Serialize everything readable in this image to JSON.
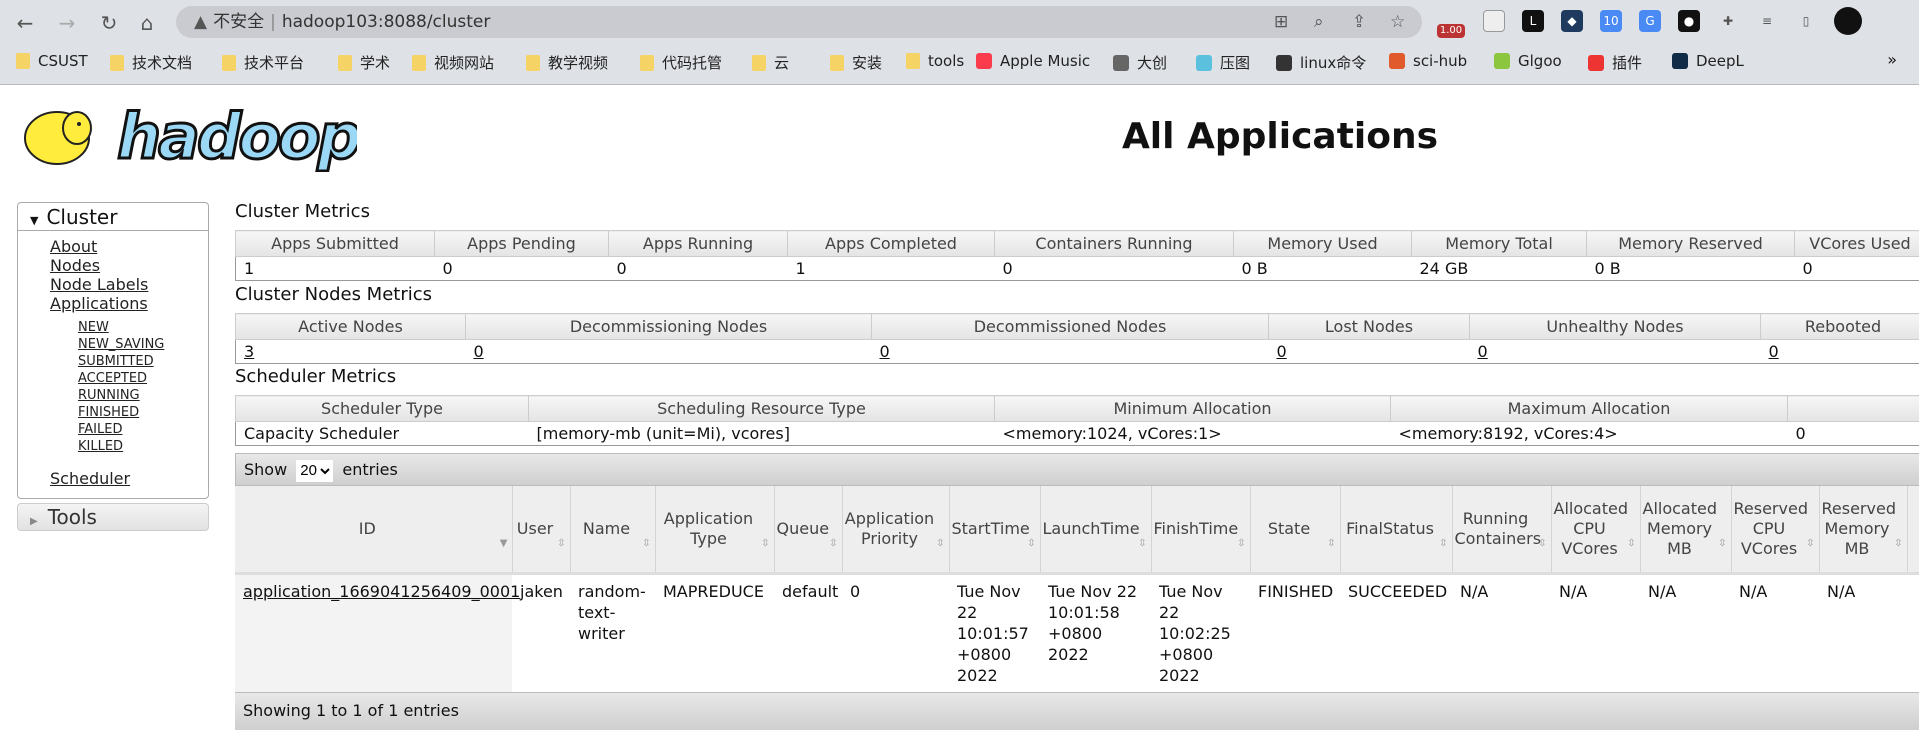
{
  "browser": {
    "security": "不安全",
    "url": "hadoop103:8088/cluster",
    "bookmarks": [
      {
        "label": "CSUST",
        "icon": "folder"
      },
      {
        "label": "技术文档",
        "icon": "folder"
      },
      {
        "label": "技术平台",
        "icon": "folder"
      },
      {
        "label": "学术",
        "icon": "folder"
      },
      {
        "label": "视频网站",
        "icon": "folder"
      },
      {
        "label": "教学视频",
        "icon": "folder"
      },
      {
        "label": "代码托管",
        "icon": "folder"
      },
      {
        "label": "云",
        "icon": "folder"
      },
      {
        "label": "安装",
        "icon": "folder"
      },
      {
        "label": "tools",
        "icon": "folder"
      },
      {
        "label": "Apple Music",
        "icon": "apple-music",
        "color": "#fa3c4c"
      },
      {
        "label": "大创",
        "icon": "globe",
        "color": "#666"
      },
      {
        "label": "压图",
        "icon": "compress",
        "color": "#5bc0de"
      },
      {
        "label": "linux命令",
        "icon": "tux",
        "color": "#333"
      },
      {
        "label": "sci-hub",
        "icon": "sci-hub",
        "color": "#e05a2b"
      },
      {
        "label": "Glgoo",
        "icon": "glgoo",
        "color": "#8cc63f"
      },
      {
        "label": "插件",
        "icon": "ex",
        "color": "#e33"
      },
      {
        "label": "DeepL",
        "icon": "deepl",
        "color": "#0f2b46"
      }
    ],
    "ext_badge": "1.00"
  },
  "page": {
    "title": "All Applications",
    "logo_text": "hadoop"
  },
  "sidebar": {
    "cluster": "Cluster",
    "links": [
      "About",
      "Nodes",
      "Node Labels",
      "Applications"
    ],
    "states": [
      "NEW",
      "NEW_SAVING",
      "SUBMITTED",
      "ACCEPTED",
      "RUNNING",
      "FINISHED",
      "FAILED",
      "KILLED"
    ],
    "scheduler": "Scheduler",
    "tools": "Tools"
  },
  "cluster_metrics": {
    "title": "Cluster Metrics",
    "headers": [
      "Apps Submitted",
      "Apps Pending",
      "Apps Running",
      "Apps Completed",
      "Containers Running",
      "Memory Used",
      "Memory Total",
      "Memory Reserved",
      "VCores Used"
    ],
    "values": [
      "1",
      "0",
      "0",
      "1",
      "0",
      "0 B",
      "24 GB",
      "0 B",
      "0"
    ]
  },
  "nodes_metrics": {
    "title": "Cluster Nodes Metrics",
    "headers": [
      "Active Nodes",
      "Decommissioning Nodes",
      "Decommissioned Nodes",
      "Lost Nodes",
      "Unhealthy Nodes",
      "Rebooted"
    ],
    "values": [
      "3",
      "0",
      "0",
      "0",
      "0",
      "0"
    ]
  },
  "scheduler_metrics": {
    "title": "Scheduler Metrics",
    "headers": [
      "Scheduler Type",
      "Scheduling Resource Type",
      "Minimum Allocation",
      "Maximum Allocation",
      ""
    ],
    "values": [
      "Capacity Scheduler",
      "[memory-mb (unit=Mi), vcores]",
      "<memory:1024, vCores:1>",
      "<memory:8192, vCores:4>",
      "0"
    ]
  },
  "apps": {
    "show": "Show",
    "entries": "entries",
    "page_size": "20",
    "headers": [
      "ID",
      "User",
      "Name",
      "Application Type",
      "Queue",
      "Application Priority",
      "StartTime",
      "LaunchTime",
      "FinishTime",
      "State",
      "FinalStatus",
      "Running Containers",
      "Allocated CPU VCores",
      "Allocated Memory MB",
      "Reserved CPU VCores",
      "Reserved Memory MB",
      ""
    ],
    "rows": [
      [
        "application_1669041256409_0001",
        "jaken",
        "random-text-writer",
        "MAPREDUCE",
        "default",
        "0",
        "Tue Nov 22 10:01:57 +0800 2022",
        "Tue Nov 22 10:01:58 +0800 2022",
        "Tue Nov 22 10:02:25 +0800 2022",
        "FINISHED",
        "SUCCEEDED",
        "N/A",
        "N/A",
        "N/A",
        "N/A",
        "N/A",
        ""
      ]
    ],
    "footer": "Showing 1 to 1 of 1 entries"
  }
}
